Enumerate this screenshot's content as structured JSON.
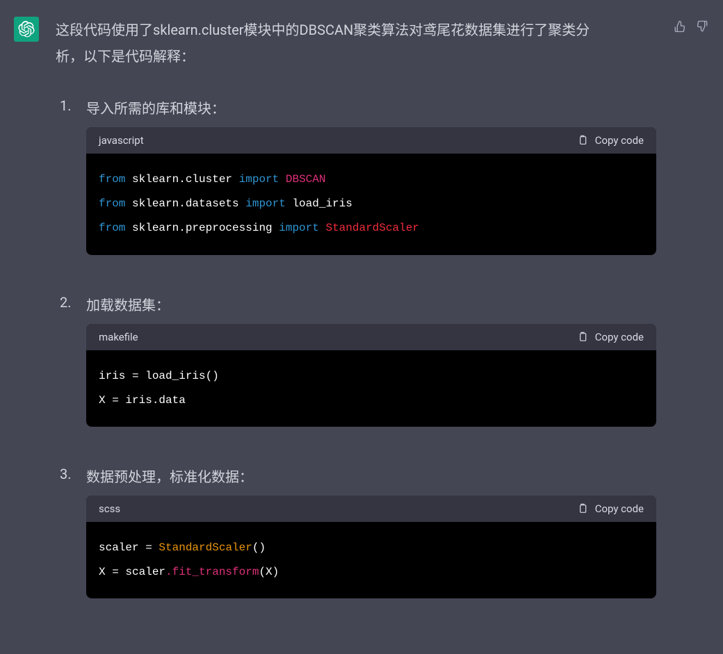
{
  "intro": "这段代码使用了sklearn.cluster模块中的DBSCAN聚类算法对鸢尾花数据集进行了聚类分析，以下是代码解释：",
  "copy_label": "Copy code",
  "steps": [
    {
      "title": "导入所需的库和模块：",
      "lang": "javascript",
      "code": [
        [
          {
            "t": "from",
            "c": "tk-kw"
          },
          {
            "t": " sklearn."
          },
          {
            "t": "cluster",
            "c": ""
          },
          {
            "t": " "
          },
          {
            "t": "import",
            "c": "tk-kw"
          },
          {
            "t": " "
          },
          {
            "t": "DBSCAN",
            "c": "tk-pink"
          }
        ],
        [
          {
            "t": "from",
            "c": "tk-kw"
          },
          {
            "t": " sklearn.datasets "
          },
          {
            "t": "import",
            "c": "tk-kw"
          },
          {
            "t": " load_iris"
          }
        ],
        [
          {
            "t": "from",
            "c": "tk-kw"
          },
          {
            "t": " sklearn.preprocessing "
          },
          {
            "t": "import",
            "c": "tk-kw"
          },
          {
            "t": " "
          },
          {
            "t": "StandardScaler",
            "c": "tk-red"
          }
        ]
      ]
    },
    {
      "title": "加载数据集：",
      "lang": "makefile",
      "code": [
        [
          {
            "t": "iris = load_iris()"
          }
        ],
        [
          {
            "t": "X = iris.data"
          }
        ]
      ]
    },
    {
      "title": "数据预处理，标准化数据：",
      "lang": "scss",
      "code": [
        [
          {
            "t": "scaler = "
          },
          {
            "t": "StandardScaler",
            "c": "tk-yel"
          },
          {
            "t": "()"
          }
        ],
        [
          {
            "t": "X = scaler"
          },
          {
            "t": ".fit_transform",
            "c": "tk-pink"
          },
          {
            "t": "(X)"
          }
        ]
      ]
    }
  ]
}
